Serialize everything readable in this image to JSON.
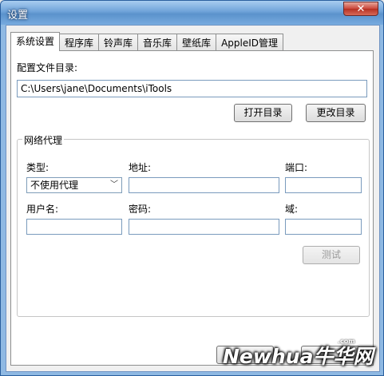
{
  "window": {
    "title": "设置",
    "close_glyph": "✕"
  },
  "tabs": [
    {
      "label": "系统设置",
      "active": true
    },
    {
      "label": "程序库",
      "active": false
    },
    {
      "label": "铃声库",
      "active": false
    },
    {
      "label": "音乐库",
      "active": false
    },
    {
      "label": "壁纸库",
      "active": false
    },
    {
      "label": "AppleID管理",
      "active": false
    }
  ],
  "config": {
    "label": "配置文件目录:",
    "path": "C:\\Users\\jane\\Documents\\iTools",
    "open_button": "打开目录",
    "change_button": "更改目录"
  },
  "proxy": {
    "group_title": "网络代理",
    "type_label": "类型:",
    "type_value": "不使用代理",
    "address_label": "地址:",
    "port_label": "端口:",
    "username_label": "用户名:",
    "password_label": "密码:",
    "domain_label": "域:",
    "test_button": "测试"
  },
  "watermark": {
    "text": "Newhua牛华网",
    "suffix": ".com"
  }
}
